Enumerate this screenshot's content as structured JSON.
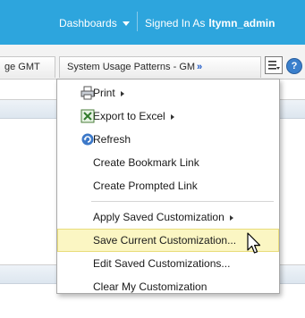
{
  "header": {
    "dashboards_label": "Dashboards",
    "signed_in_label": "Signed In As",
    "user": "ltymn_admin"
  },
  "tabs": [
    {
      "label": "ge GMT"
    },
    {
      "label": "System Usage Patterns - GM"
    }
  ],
  "tabs_more_label": "»",
  "help_label": "?",
  "menu": {
    "items": [
      {
        "label": "Print",
        "icon": "printer-icon",
        "submenu": true
      },
      {
        "label": "Export to Excel",
        "icon": "excel-icon",
        "submenu": true
      },
      {
        "label": "Refresh",
        "icon": "refresh-icon",
        "submenu": false
      },
      {
        "label": "Create Bookmark Link"
      },
      {
        "label": "Create Prompted Link"
      },
      {
        "label": "Apply Saved Customization",
        "submenu": true
      },
      {
        "label": "Save Current Customization..."
      },
      {
        "label": "Edit Saved Customizations..."
      },
      {
        "label": "Clear My Customization"
      }
    ]
  },
  "colors": {
    "header_bg": "#2da5dd",
    "highlight_bg": "#fbf6c3"
  }
}
